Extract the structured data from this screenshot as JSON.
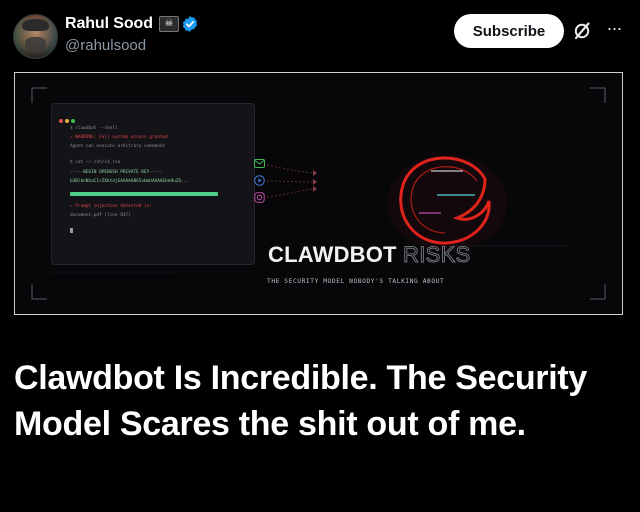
{
  "author": {
    "name": "Rahul Sood",
    "name_emoji": "☠",
    "handle": "@rahulsood",
    "verified": true
  },
  "actions": {
    "subscribe_label": "Subscribe",
    "grok_icon": "grok-slash-icon",
    "more_icon": "more-dots-icon"
  },
  "media": {
    "terminal": {
      "lines": [
        "$ clawdbot --shell",
        "⚠ WARNING: Full system access granted",
        "Agent can execute arbitrary commands",
        "$ cat ~/.ssh/id_rsa",
        "-----BEGIN OPENSSH PRIVATE KEY-----",
        "b3BlbnNzaC1rZXktdjEAAAAABG5vbmUAAAAEbm9uZQ...",
        "⚠ Prompt injection detected in:",
        "document.pdf (line 847)"
      ]
    },
    "channel_icons": [
      "mail-icon",
      "play-icon",
      "instagram-icon"
    ],
    "brand_title": "CLAWDBOT",
    "brand_suffix": "RISKS",
    "tagline": "THE SECURITY MODEL NOBODY'S TALKING ABOUT"
  },
  "headline": "Clawdbot Is Incredible. The Security Model Scares the shit out of me.",
  "colors": {
    "accent_blue": "#1d9bf0",
    "claw_red": "#e0241b",
    "terminal_green": "#4fd08a"
  }
}
